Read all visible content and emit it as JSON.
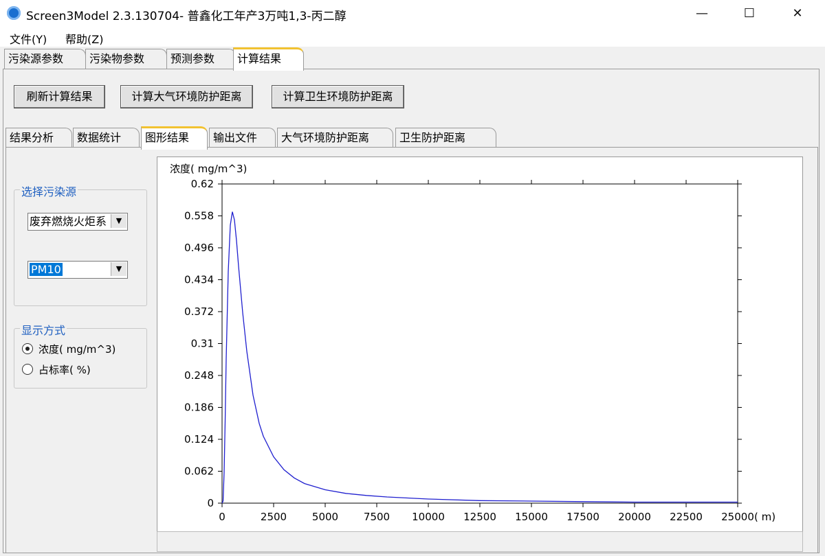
{
  "window": {
    "title": "Screen3Model 2.3.130704- 普鑫化工年产3万吨1,3-丙二醇",
    "minimize": "—",
    "maximize": "☐",
    "close": "✕"
  },
  "menu": {
    "file": "文件(Y)",
    "help": "帮助(Z)"
  },
  "main_tabs": [
    "污染源参数",
    "污染物参数",
    "预测参数",
    "计算结果"
  ],
  "buttons": {
    "refresh": "刷新计算结果",
    "atmos_distance": "计算大气环境防护距离",
    "sanitary_distance": "计算卫生环境防护距离"
  },
  "sub_tabs": [
    "结果分析",
    "数据统计",
    "图形结果",
    "输出文件",
    "大气环境防护距离",
    "卫生防护距离"
  ],
  "source_group": {
    "title": "选择污染源",
    "source_value": "废弃燃烧火炬系",
    "pollutant_value": "PM10"
  },
  "display_group": {
    "title": "显示方式",
    "option_concentration": "浓度( mg/m^3)",
    "option_ratio": "占标率( %)",
    "selected": "concentration"
  },
  "chart_data": {
    "type": "line",
    "ylabel": "浓度( mg/m^3)",
    "xlabel": "( m)",
    "xlim": [
      0,
      25000
    ],
    "ylim": [
      0,
      0.62
    ],
    "x_ticks": [
      0,
      2500,
      5000,
      7500,
      10000,
      12500,
      15000,
      17500,
      20000,
      22500,
      25000
    ],
    "y_ticks": [
      "0",
      "0.062",
      "0.124",
      "0.186",
      "0.248",
      "0.31",
      "0.372",
      "0.434",
      "0.496",
      "0.558",
      "0.62"
    ],
    "line_color": "#1f1fcf",
    "x": [
      0,
      50,
      100,
      150,
      200,
      300,
      400,
      500,
      600,
      700,
      800,
      1000,
      1200,
      1500,
      1800,
      2000,
      2500,
      3000,
      3500,
      4000,
      5000,
      6000,
      7000,
      8000,
      10000,
      12500,
      15000,
      17500,
      20000,
      22500,
      25000
    ],
    "y": [
      0,
      0.004,
      0.06,
      0.16,
      0.28,
      0.45,
      0.54,
      0.566,
      0.55,
      0.51,
      0.46,
      0.37,
      0.295,
      0.21,
      0.155,
      0.13,
      0.09,
      0.065,
      0.049,
      0.038,
      0.026,
      0.019,
      0.015,
      0.012,
      0.008,
      0.005,
      0.004,
      0.003,
      0.002,
      0.002,
      0.002
    ]
  }
}
